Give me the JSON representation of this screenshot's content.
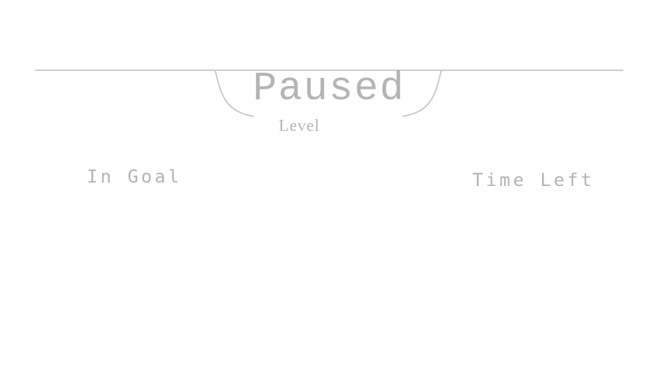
{
  "pause_panel": {
    "title": "Paused",
    "subtitle": "Level"
  },
  "hud": {
    "in_goal_label": "In Goal",
    "time_left_label": "Time Left"
  },
  "colors": {
    "text": "#b4b4b4",
    "line": "#c8c8c8",
    "background": "#ffffff"
  }
}
